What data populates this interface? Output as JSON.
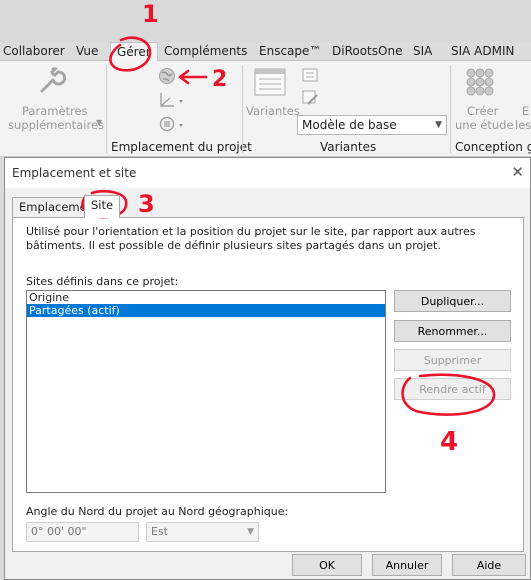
{
  "ribbon": {
    "tabs": [
      "Collaborer",
      "Vue",
      "Gérer",
      "Compléments",
      "Enscape™",
      "DiRootsOne",
      "SIA",
      "SIA ADMIN"
    ],
    "params_label_1": "Paramètres",
    "params_label_2": "supplémentaires",
    "location_panel_title": "Emplacement du projet",
    "variants_label": "Variantes",
    "variants_combo": "Modèle de base",
    "variants_panel_title": "Variantes",
    "create_label_1": "Créer",
    "create_label_2": "une étude",
    "cut_label_1": "E",
    "cut_label_2": "les",
    "design_panel_title": "Conception gé"
  },
  "dialog": {
    "title": "Emplacement et site",
    "tabs": [
      "Emplacement",
      "Site"
    ],
    "description": "Utilisé pour l'orientation et la position du projet sur le site, par rapport aux autres bâtiments. Il est possible de définir plusieurs sites partagés dans un projet.",
    "sites_label": "Sites définis dans ce projet:",
    "sites": [
      "Origine",
      "Partagées (actif)"
    ],
    "buttons": {
      "duplicate": "Dupliquer...",
      "rename": "Renommer...",
      "delete": "Supprimer",
      "make_active": "Rendre actif"
    },
    "angle_label": "Angle du Nord du projet au Nord géographique:",
    "angle_value": "0° 00' 00\"",
    "direction_value": "Est",
    "footer": {
      "ok": "OK",
      "cancel": "Annuler",
      "help": "Aide"
    }
  },
  "annotations": {
    "step_1": "1",
    "step_2": "2",
    "step_3": "3",
    "step_4": "4"
  },
  "colors": {
    "accent": "#0078d7",
    "annotation": "#e8142a"
  }
}
